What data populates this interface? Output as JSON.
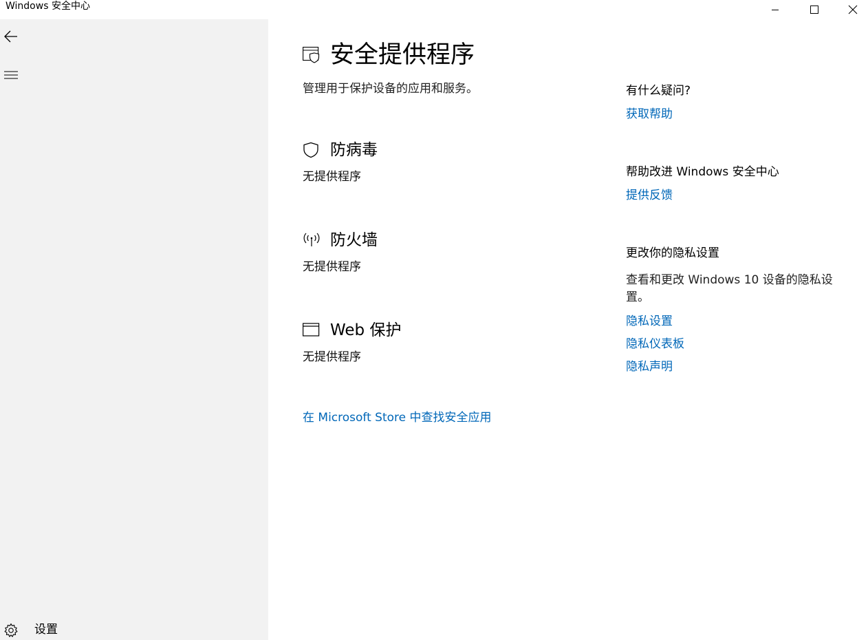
{
  "window": {
    "title": "Windows 安全中心"
  },
  "sidebar": {
    "settings_label": "设置"
  },
  "page": {
    "title": "安全提供程序",
    "description": "管理用于保护设备的应用和服务。",
    "sections": [
      {
        "title": "防病毒",
        "status": "无提供程序",
        "icon": "shield-icon"
      },
      {
        "title": "防火墙",
        "status": "无提供程序",
        "icon": "antenna-icon"
      },
      {
        "title": "Web 保护",
        "status": "无提供程序",
        "icon": "browser-window-icon"
      }
    ],
    "store_link": "在 Microsoft Store 中查找安全应用"
  },
  "side": {
    "help_heading": "有什么疑问?",
    "help_link": "获取帮助",
    "improve_heading": "帮助改进 Windows 安全中心",
    "feedback_link": "提供反馈",
    "privacy_heading": "更改你的隐私设置",
    "privacy_text": "查看和更改 Windows 10 设备的隐私设置。",
    "privacy_links": [
      "隐私设置",
      "隐私仪表板",
      "隐私声明"
    ]
  },
  "colors": {
    "link": "#0067b8",
    "sidebar_bg": "#f2f2f2"
  }
}
